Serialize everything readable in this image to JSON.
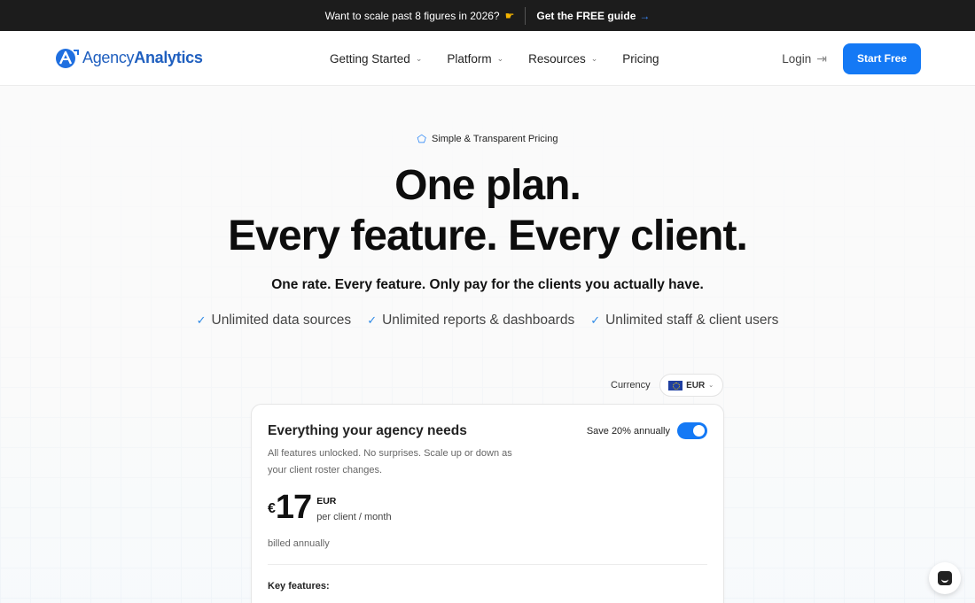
{
  "promo": {
    "message": "Want to scale past 8 figures in 2026?",
    "cta_label": "Get the FREE guide",
    "hand_icon": "pointing-hand-emoji",
    "arrow_icon": "arrow-right-icon"
  },
  "header": {
    "logo_text_regular": "Agency",
    "logo_text_bold": "Analytics",
    "nav": [
      {
        "label": "Getting Started",
        "dropdown": true
      },
      {
        "label": "Platform",
        "dropdown": true
      },
      {
        "label": "Resources",
        "dropdown": true
      },
      {
        "label": "Pricing",
        "dropdown": false
      }
    ],
    "login_label": "Login",
    "start_label": "Start Free"
  },
  "hero": {
    "eyebrow": "Simple & Transparent Pricing",
    "headline_line1": "One plan.",
    "headline_line2": "Every feature. Every client.",
    "subheading": "One rate. Every feature. Only pay for the clients you actually have.",
    "checks": [
      "Unlimited data sources",
      "Unlimited reports & dashboards",
      "Unlimited staff & client users"
    ]
  },
  "currency": {
    "label": "Currency",
    "selected": "EUR"
  },
  "card": {
    "title": "Everything your agency needs",
    "save_label": "Save 20% annually",
    "save_toggle_on": true,
    "description": "All features unlocked. No surprises. Scale up or down as your client roster changes.",
    "price_symbol": "€",
    "price_amount": "17",
    "price_currency": "EUR",
    "price_period": "per client / month",
    "billed": "billed annually",
    "key_features_label": "Key features:"
  },
  "colors": {
    "accent": "#1479f5",
    "banner_bg": "#1c1c1c",
    "check": "#2f8ae6"
  }
}
